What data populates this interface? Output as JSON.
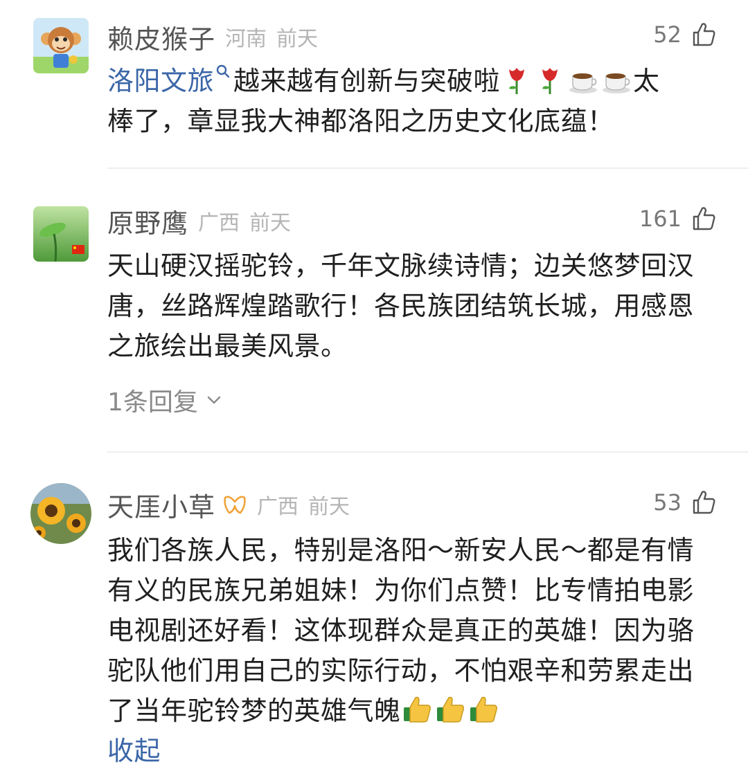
{
  "comments": [
    {
      "username": "赖皮猴子",
      "location": "河南",
      "time": "前天",
      "likes": "52",
      "text_link": "洛阳文旅",
      "text_a": "越来越有创新与突破啦",
      "text_b": "太",
      "text_c": "棒了，章显我大神都洛阳之历史文化底蕴！",
      "emojis_a": [
        "rose-emoji",
        "rose-emoji",
        "coffee-emoji",
        "coffee-emoji"
      ],
      "avatar": "monkey-cartoon-avatar"
    },
    {
      "username": "原野鹰",
      "location": "广西",
      "time": "前天",
      "likes": "161",
      "text": "天山硬汉摇驼铃，千年文脉续诗情；边关悠梦回汉唐，丝路辉煌踏歌行！各民族团结筑长城，用感恩之旅绘出最美风景。",
      "replies_label": "1条回复",
      "avatar": "green-leaf-flag-avatar"
    },
    {
      "username": "天厓小草",
      "location": "广西",
      "time": "前天",
      "likes": "53",
      "text": "我们各族人民，特别是洛阳～新安人民～都是有情有义的民族兄弟姐妹！为你们点赞！比专情拍电影电视剧还好看！这体现群众是真正的英雄！因为骆驼队他们用自己的实际行动，不怕艰辛和劳累走出了当年驼铃梦的英雄气魄",
      "emojis": [
        "thumbs-up-emoji",
        "thumbs-up-emoji",
        "thumbs-up-emoji"
      ],
      "collapse_label": "收起",
      "avatar": "sunflower-avatar",
      "badge": "orange-badge-icon"
    }
  ],
  "colors": {
    "link": "#3b66a8",
    "username": "#555555",
    "meta": "#b5b5b5",
    "body_text": "#1f1f1f",
    "divider": "#eeeeee"
  }
}
